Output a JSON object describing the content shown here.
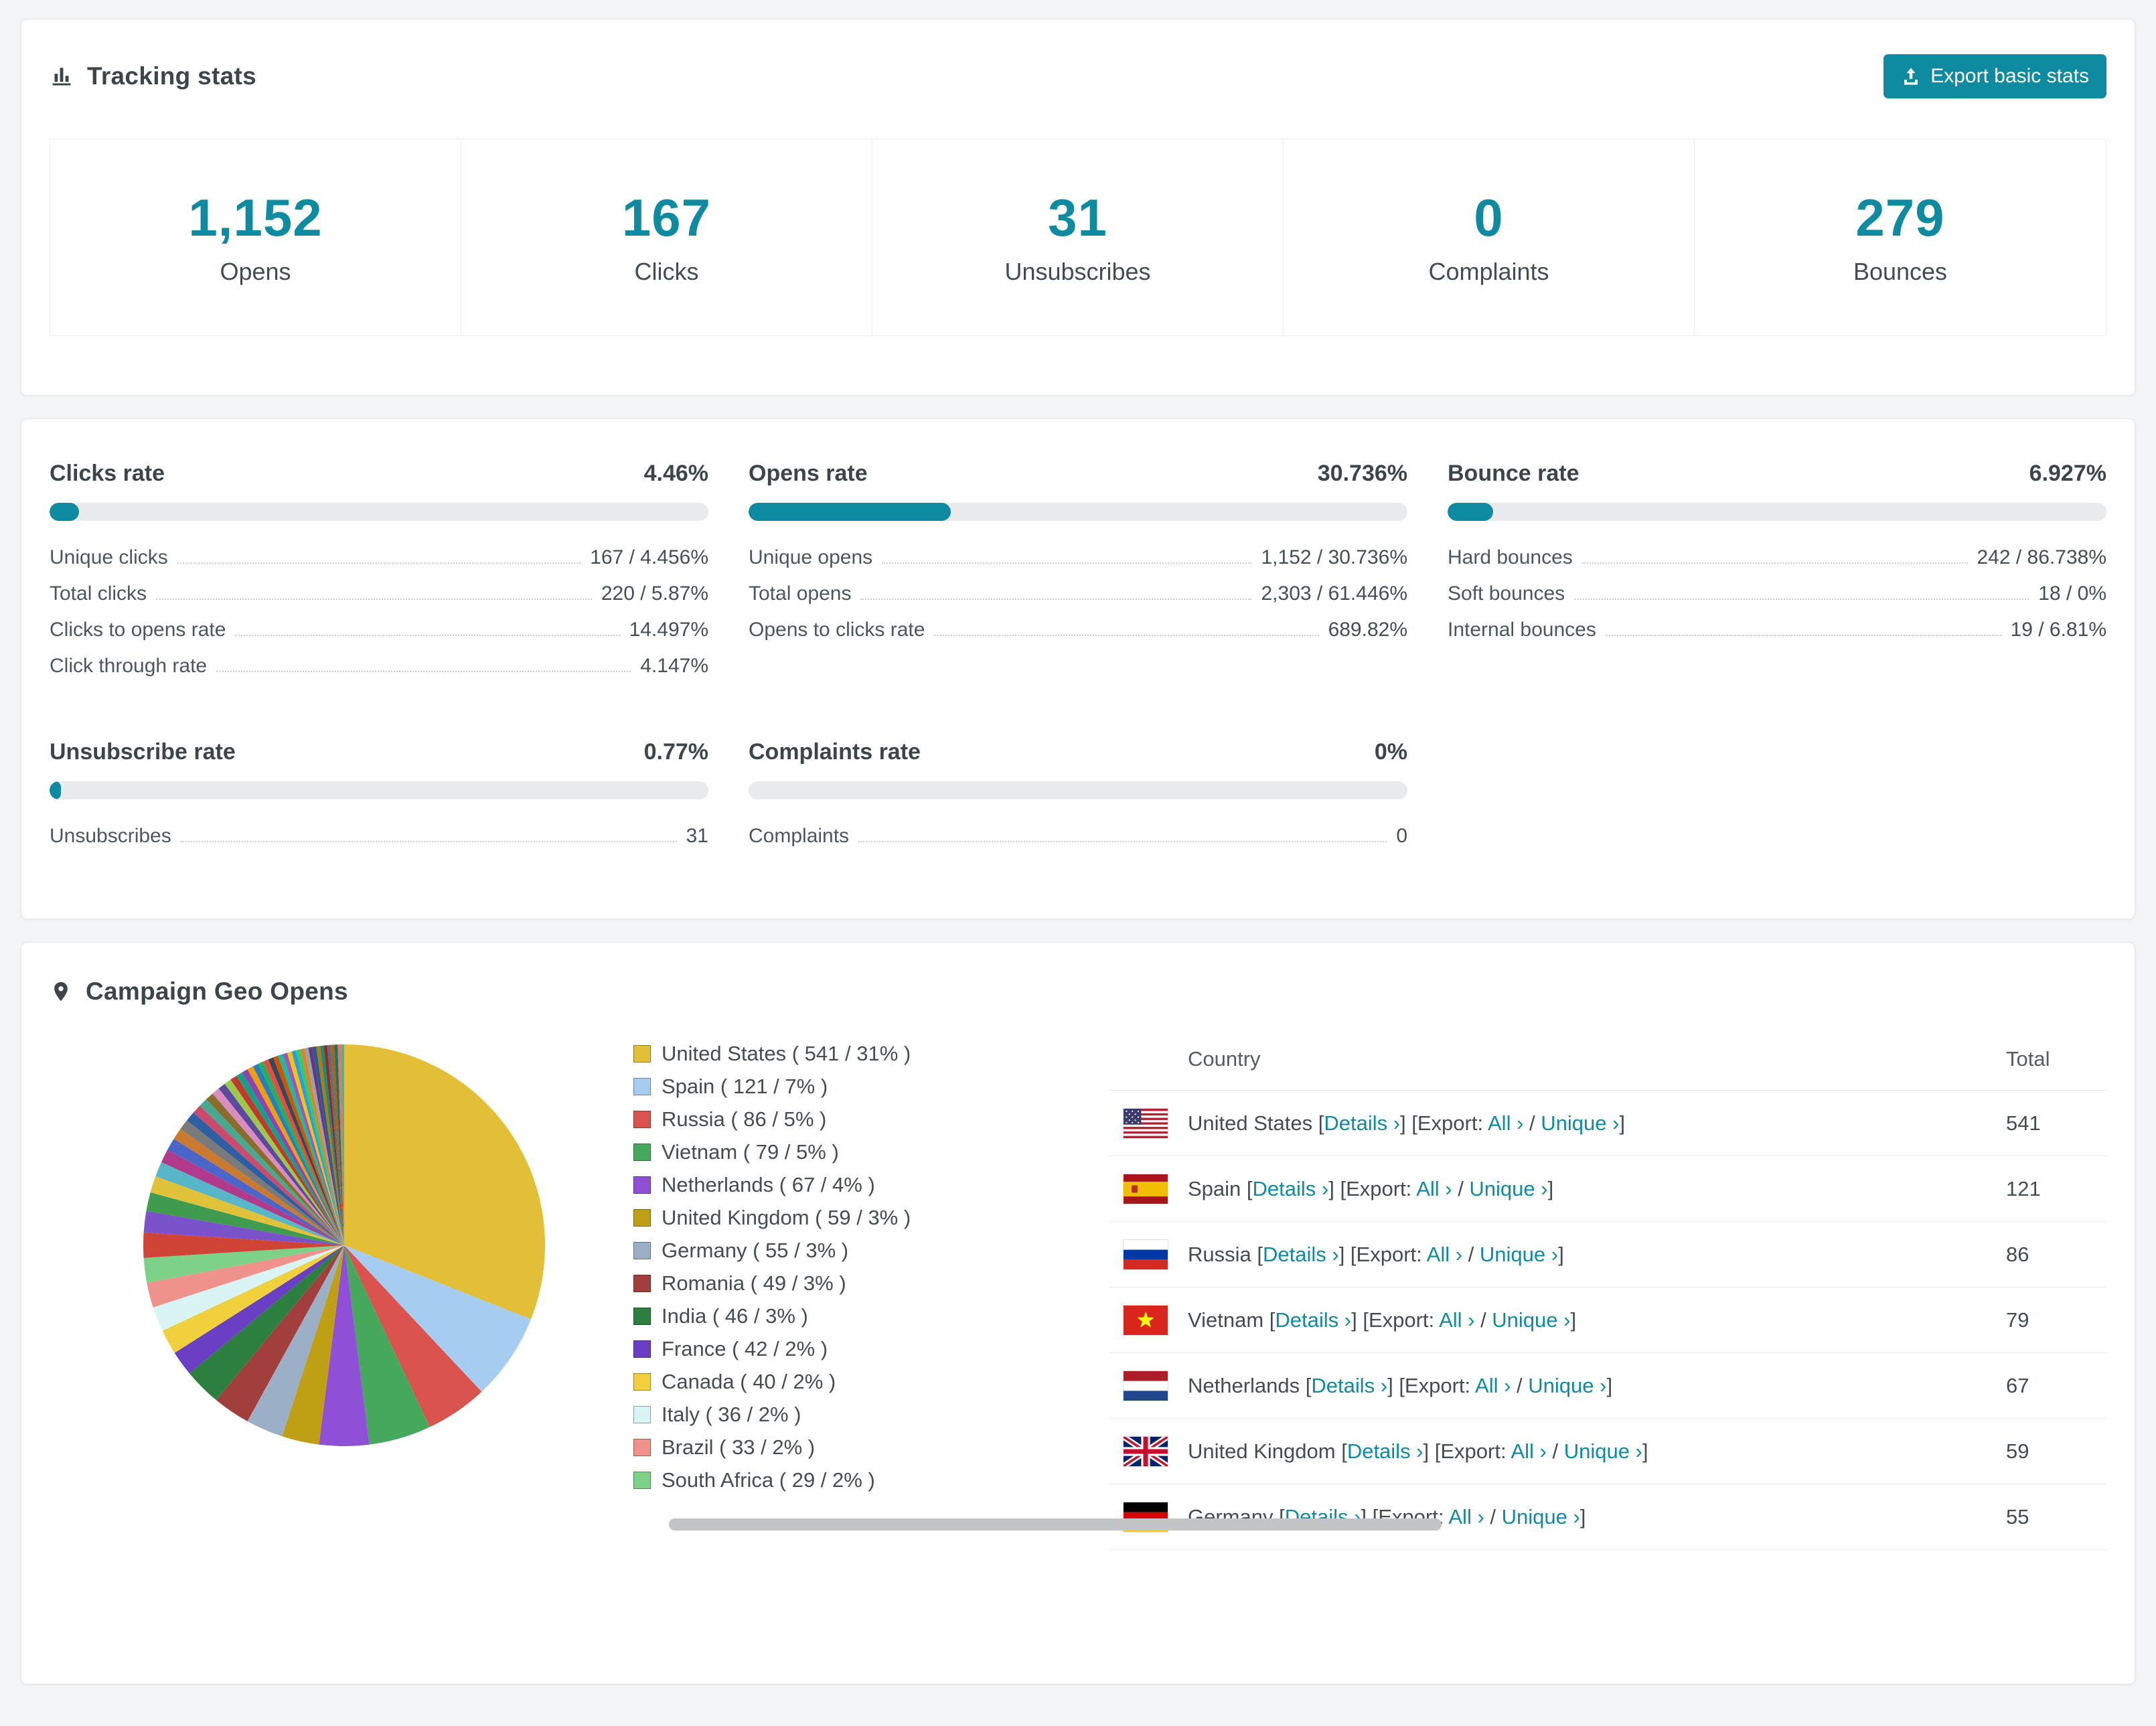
{
  "theme": {
    "accent": "#0e8ba0",
    "page_bg": "#f4f5f6",
    "card_border": "#e4e5e6",
    "bar_track": "#e9eaeb",
    "text_dark": "#3e4549",
    "text_gray": "#565c60",
    "scrollbar": "#c2c4c5"
  },
  "icons": {
    "bar-chart-icon": "column chart glyph",
    "export-icon": "upload tray glyph",
    "location-pin-icon": "map marker glyph"
  },
  "header": {
    "title": "Tracking stats",
    "export_button": "Export basic stats"
  },
  "stats": [
    {
      "value": "1,152",
      "label": "Opens"
    },
    {
      "value": "167",
      "label": "Clicks"
    },
    {
      "value": "31",
      "label": "Unsubscribes"
    },
    {
      "value": "0",
      "label": "Complaints"
    },
    {
      "value": "279",
      "label": "Bounces"
    }
  ],
  "rates": [
    {
      "title": "Clicks rate",
      "value": "4.46%",
      "percent": 4.46,
      "rows": [
        {
          "label": "Unique clicks",
          "value": "167 / 4.456%"
        },
        {
          "label": "Total clicks",
          "value": "220 / 5.87%"
        },
        {
          "label": "Clicks to opens rate",
          "value": "14.497%"
        },
        {
          "label": "Click through rate",
          "value": "4.147%"
        }
      ]
    },
    {
      "title": "Opens rate",
      "value": "30.736%",
      "percent": 30.736,
      "rows": [
        {
          "label": "Unique opens",
          "value": "1,152 / 30.736%"
        },
        {
          "label": "Total opens",
          "value": "2,303 / 61.446%"
        },
        {
          "label": "Opens to clicks rate",
          "value": "689.82%"
        }
      ]
    },
    {
      "title": "Bounce rate",
      "value": "6.927%",
      "percent": 6.927,
      "rows": [
        {
          "label": "Hard bounces",
          "value": "242 / 86.738%"
        },
        {
          "label": "Soft bounces",
          "value": "18 / 0%"
        },
        {
          "label": "Internal bounces",
          "value": "19 / 6.81%"
        }
      ]
    },
    {
      "title": "Unsubscribe rate",
      "value": "0.77%",
      "percent": 0.77,
      "rows": [
        {
          "label": "Unsubscribes",
          "value": "31"
        }
      ]
    },
    {
      "title": "Complaints rate",
      "value": "0%",
      "percent": 0,
      "rows": [
        {
          "label": "Complaints",
          "value": "0"
        }
      ]
    }
  ],
  "geo": {
    "title": "Campaign Geo Opens",
    "table": {
      "columns": [
        "Country",
        "Total"
      ],
      "bracket_open": "[",
      "bracket_close": "]",
      "details_label": "Details ›",
      "export_prefix": "[Export:",
      "all_label": "All ›",
      "separator": "/",
      "unique_label": "Unique ›",
      "rows": [
        {
          "country": "United States",
          "total": "541",
          "flag": "us"
        },
        {
          "country": "Spain",
          "total": "121",
          "flag": "es"
        },
        {
          "country": "Russia",
          "total": "86",
          "flag": "ru"
        },
        {
          "country": "Vietnam",
          "total": "79",
          "flag": "vn"
        },
        {
          "country": "Netherlands",
          "total": "67",
          "flag": "nl"
        },
        {
          "country": "United Kingdom",
          "total": "59",
          "flag": "gb"
        },
        {
          "country": "Germany",
          "total": "55",
          "flag": "de"
        }
      ]
    }
  },
  "chart_data": {
    "type": "pie",
    "title": "Campaign Geo Opens",
    "legend_position": "right",
    "legend_format": "{label} ( {count} / {pct}% )",
    "slices": [
      {
        "label": "United States",
        "count": 541,
        "pct": 31,
        "color": "#e3bf37"
      },
      {
        "label": "Spain",
        "count": 121,
        "pct": 7,
        "color": "#a6cdf0"
      },
      {
        "label": "Russia",
        "count": 86,
        "pct": 5,
        "color": "#d9534f"
      },
      {
        "label": "Vietnam",
        "count": 79,
        "pct": 5,
        "color": "#45a85c"
      },
      {
        "label": "Netherlands",
        "count": 67,
        "pct": 4,
        "color": "#8f4fd6"
      },
      {
        "label": "United Kingdom",
        "count": 59,
        "pct": 3,
        "color": "#bfa014"
      },
      {
        "label": "Germany",
        "count": 55,
        "pct": 3,
        "color": "#9bafc6"
      },
      {
        "label": "Romania",
        "count": 49,
        "pct": 3,
        "color": "#a03f3c"
      },
      {
        "label": "India",
        "count": 46,
        "pct": 3,
        "color": "#2c7f3f"
      },
      {
        "label": "France",
        "count": 42,
        "pct": 2,
        "color": "#6a3fc4"
      },
      {
        "label": "Canada",
        "count": 40,
        "pct": 2,
        "color": "#f0d03c"
      },
      {
        "label": "Italy",
        "count": 36,
        "pct": 2,
        "color": "#d9f4f4"
      },
      {
        "label": "Brazil",
        "count": 33,
        "pct": 2,
        "color": "#f0928c"
      },
      {
        "label": "South Africa",
        "count": 29,
        "pct": 2,
        "color": "#7ed287"
      }
    ],
    "other_pct": 26,
    "other_palette": [
      "#cf4436",
      "#7a52c9",
      "#3f9b4e",
      "#e0c23a",
      "#58b6c9",
      "#b03a8c",
      "#4b65c9",
      "#c97a2e",
      "#7a7a7a",
      "#2f5fa3",
      "#c94b6e",
      "#49a890",
      "#8a6d2c",
      "#d98cc0",
      "#5b4a9e",
      "#9bc94b",
      "#c0392b",
      "#16a085",
      "#8e44ad",
      "#f39c12",
      "#2980b9",
      "#27ae60",
      "#e74c3c",
      "#34495e",
      "#d35400",
      "#1abc9c",
      "#9b59b6",
      "#f1c40f",
      "#3498db",
      "#2ecc71",
      "#e67e22",
      "#95a5a6",
      "#6c3483",
      "#1f618d",
      "#b9770e",
      "#148f77",
      "#922b21",
      "#5d6d7e",
      "#af601a",
      "#117864",
      "#ec7063",
      "#45b39d"
    ]
  }
}
